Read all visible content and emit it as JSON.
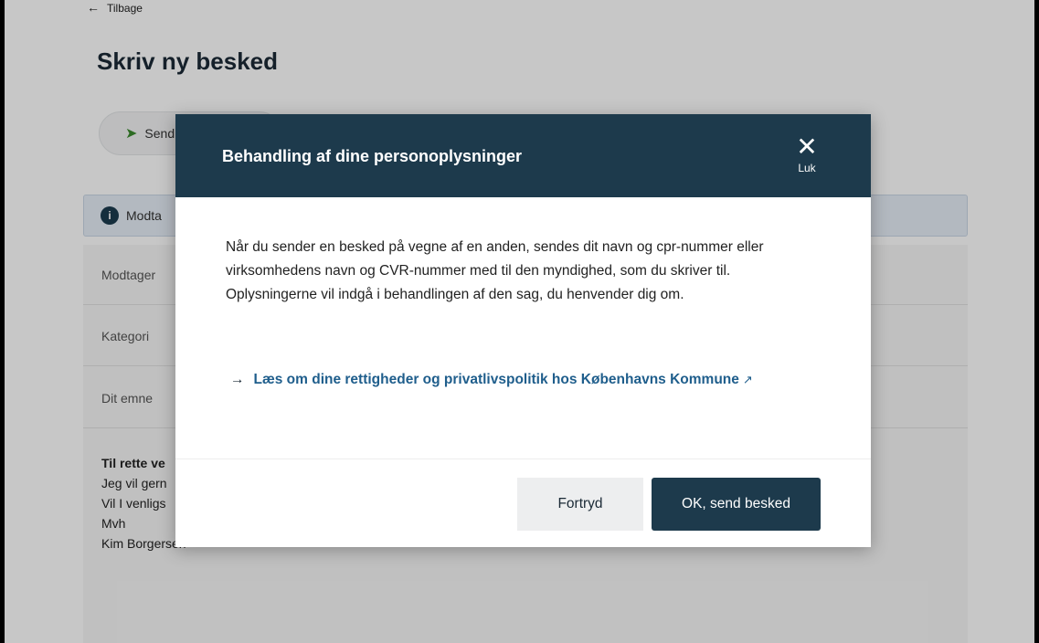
{
  "page": {
    "back_label": "Tilbage",
    "title": "Skriv ny besked",
    "send_pill_label": "Send",
    "info_banner_text": "Modta",
    "form": {
      "recipient_label": "Modtager",
      "category_label": "Kategori",
      "subject_label": "Dit emne"
    },
    "message_lines": [
      "Til rette ve",
      "Jeg vil gern",
      "Vil I venligs",
      "Mvh",
      "Kim Borgersen"
    ]
  },
  "modal": {
    "title": "Behandling af dine personoplysninger",
    "close_label": "Luk",
    "body": "Når du sender en besked på vegne af en anden, sendes dit navn og cpr-nummer eller virksomhedens navn og CVR-nummer med til den myndighed, som du skriver til. Oplysningerne vil indgå i behandlingen af den sag, du henvender dig om.",
    "link_text": "Læs om dine rettigheder og privatlivspolitik hos Københavns Kommune",
    "cancel_label": "Fortryd",
    "ok_label": "OK, send besked"
  },
  "colors": {
    "header_bg": "#1d3a4c",
    "link": "#1f5e8c",
    "primary_button": "#1d3a4c"
  }
}
